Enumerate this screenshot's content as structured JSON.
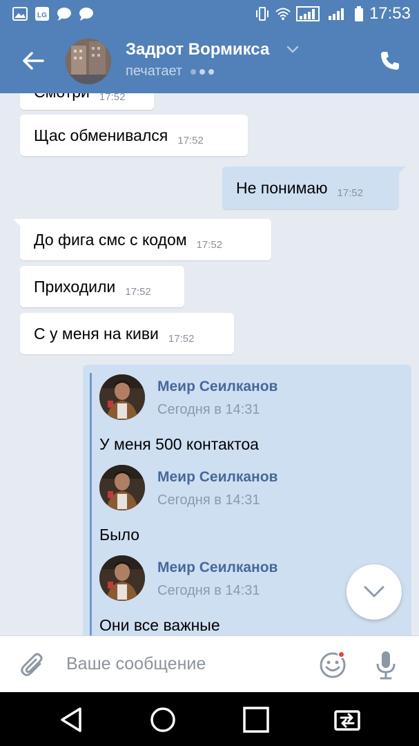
{
  "status_bar": {
    "time": "17:53",
    "icons": [
      "gallery-icon",
      "lg-icon",
      "chat-bubble-icon",
      "chat-bubble-icon",
      "vibrate-icon",
      "wifi-icon",
      "signal-icon",
      "signal-icon",
      "battery-icon"
    ]
  },
  "header": {
    "contact_name": "Задрот Вормикса",
    "status": "печатает",
    "icons": [
      "back-arrow-icon",
      "chevron-down-icon",
      "phone-icon"
    ]
  },
  "messages": [
    {
      "text": "Смотри",
      "time": "17:52",
      "direction": "in"
    },
    {
      "text": "Щас обменивался",
      "time": "17:52",
      "direction": "in"
    },
    {
      "text": "Не понимаю",
      "time": "17:52",
      "direction": "out"
    },
    {
      "text": "До фига смс с кодом",
      "time": "17:52",
      "direction": "in"
    },
    {
      "text": "Приходили",
      "time": "17:52",
      "direction": "in"
    },
    {
      "text": "С у меня на киви",
      "time": "17:52",
      "direction": "in"
    }
  ],
  "forwarded": [
    {
      "author": "Меир Сеилканов",
      "date": "Сегодня в 14:31",
      "text": "У меня 500 контактоа"
    },
    {
      "author": "Меир Сеилканов",
      "date": "Сегодня в 14:31",
      "text": "Было"
    },
    {
      "author": "Меир Сеилканов",
      "date": "Сегодня в 14:31",
      "text": "Они все важные"
    }
  ],
  "composer": {
    "placeholder": "Ваше сообщение",
    "icons": [
      "attach-icon",
      "emoji-icon",
      "mic-icon"
    ]
  },
  "colors": {
    "header": "#5181b8",
    "chat_background": "#e6ebf2",
    "outgoing_bubble": "#cfdff2",
    "forward_author": "#46699a",
    "notification_dot": "#e64646"
  }
}
